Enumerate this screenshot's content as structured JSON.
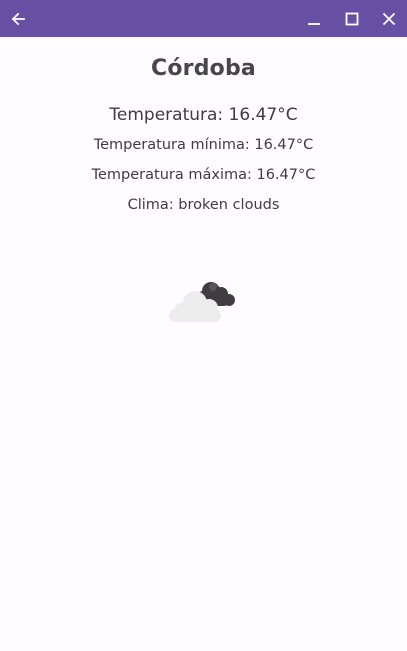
{
  "window": {
    "accent_color": "#6750a4",
    "background_color": "#fffbfe",
    "controls": {
      "back_icon": "arrow-left-icon",
      "minimize_icon": "minimize-icon",
      "maximize_icon": "maximize-icon",
      "close_icon": "close-icon"
    }
  },
  "weather": {
    "city": "Córdoba",
    "temperature": "Temperatura: 16.47°C",
    "temp_min": "Temperatura mínima: 16.47°C",
    "temp_max": "Temperatura máxima: 16.47°C",
    "condition": "Clima: broken clouds",
    "icon": "broken-clouds-icon"
  }
}
